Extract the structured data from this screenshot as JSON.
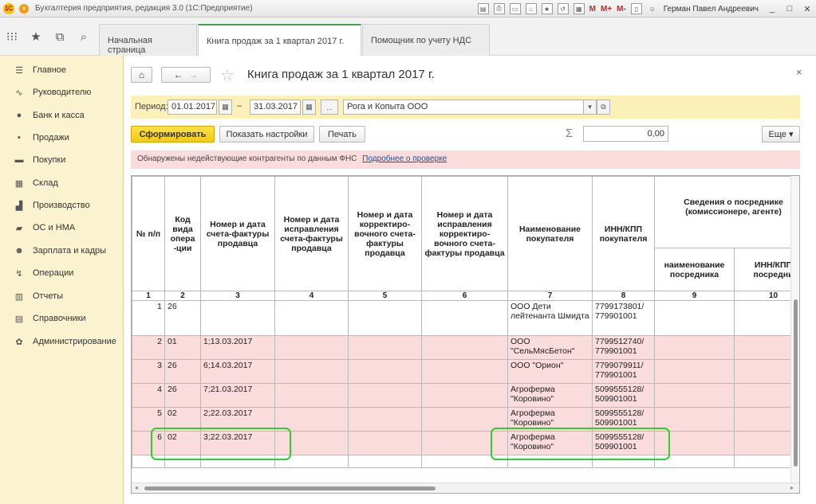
{
  "titlebar": {
    "title": "Бухгалтерия предприятия, редакция 3.0  (1С:Предприятие)",
    "logo": "1С",
    "icons": [
      "save-icon",
      "print-icon",
      "preview-icon",
      "home-icon",
      "star-icon",
      "history-icon",
      "calc-icon"
    ],
    "m_labels": [
      "M",
      "M+",
      "M-"
    ],
    "user": "Герман Павел Андреевич",
    "window_buttons": [
      "_",
      "□",
      "✕"
    ]
  },
  "top_tabs": [
    {
      "label": "Начальная страница"
    },
    {
      "label": "Книга продаж за 1 квартал 2017 г."
    },
    {
      "label": "Помощник по учету НДС"
    }
  ],
  "sidebar": {
    "items": [
      {
        "label": "Главное",
        "icon": "☰"
      },
      {
        "label": "Руководителю",
        "icon": "∿"
      },
      {
        "label": "Банк и касса",
        "icon": "●"
      },
      {
        "label": "Продажи",
        "icon": "▪"
      },
      {
        "label": "Покупки",
        "icon": "▬"
      },
      {
        "label": "Склад",
        "icon": "▦"
      },
      {
        "label": "Производство",
        "icon": "▟"
      },
      {
        "label": "ОС и НМА",
        "icon": "▰"
      },
      {
        "label": "Зарплата и кадры",
        "icon": "☻"
      },
      {
        "label": "Операции",
        "icon": "↯"
      },
      {
        "label": "Отчеты",
        "icon": "▥"
      },
      {
        "label": "Справочники",
        "icon": "▤"
      },
      {
        "label": "Администрирование",
        "icon": "✿"
      }
    ]
  },
  "doc": {
    "title": "Книга продаж за 1 квартал 2017 г.",
    "period_label": "Период:",
    "date_from": "01.01.2017",
    "date_to": "31.03.2017",
    "dash": "–",
    "ellipsis": "...",
    "organization": "Рога и Копыта ООО",
    "btn_generate": "Сформировать",
    "btn_settings": "Показать настройки",
    "btn_print": "Печать",
    "sigma": "Σ",
    "sum": "0,00",
    "btn_more": "Еще",
    "warning": "Обнаружены недействующие контрагенты по данным ФНС",
    "warning_link": "Подробнее о проверке",
    "close": "×"
  },
  "table": {
    "headers": {
      "h1": "№ п/п",
      "h2": "Код вида опера -ции",
      "h3": "Номер и дата счета-фактуры продавца",
      "h4": "Номер и дата исправления счета-фактуры продавца",
      "h5": "Номер и дата корректиро- вочного счета-фактуры продавца",
      "h6": "Номер и дата исправления корректиро- вочного счета-фактуры продавца",
      "h7": "Наименование покупателя",
      "h8": "ИНН/КПП покупателя",
      "h9group": "Сведения о посреднике (комиссионере, агенте)",
      "h9": "наименование посредника",
      "h10": "ИНН/КПП посредни"
    },
    "col_numbers": [
      "1",
      "2",
      "3",
      "4",
      "5",
      "6",
      "7",
      "8",
      "9",
      "10"
    ],
    "rows": [
      {
        "n": "1",
        "code": "26",
        "invoice": "",
        "buyer": "ООО Дети лейтенанта Шмидта",
        "inn": "7799173801/ 779901001",
        "style": "white"
      },
      {
        "n": "2",
        "code": "01",
        "invoice": "1;13.03.2017",
        "buyer": "ООО \"СельМясБетон\"",
        "inn": "7799512740/ 779901001",
        "style": "pink"
      },
      {
        "n": "3",
        "code": "26",
        "invoice": "6;14.03.2017",
        "buyer": "ООО \"Орион\"",
        "inn": "7799079911/ 779901001",
        "style": "pink"
      },
      {
        "n": "4",
        "code": "26",
        "invoice": "7;21.03.2017",
        "buyer": "Агроферма \"Коровино\"",
        "inn": "5099555128/ 509901001",
        "style": "pink"
      },
      {
        "n": "5",
        "code": "02",
        "invoice": "2;22.03.2017",
        "buyer": "Агроферма \"Коровино\"",
        "inn": "5099555128/ 509901001",
        "style": "pink"
      },
      {
        "n": "6",
        "code": "02",
        "invoice": "3;22.03.2017",
        "buyer": "Агроферма \"Коровино\"",
        "inn": "5099555128/ 509901001",
        "style": "pink"
      }
    ]
  },
  "colors": {
    "accent_green": "#45a04e",
    "highlight": "#2ed02e",
    "warning_bg": "#fbdcdc",
    "sidebar_bg": "#fbf3cf"
  }
}
